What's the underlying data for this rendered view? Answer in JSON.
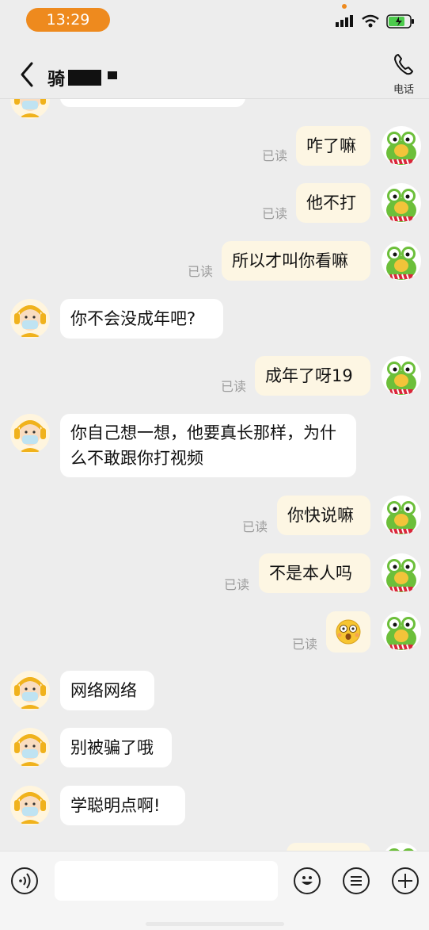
{
  "status_bar": {
    "time": "13:29"
  },
  "header": {
    "title": "骑",
    "phone_label": "电话"
  },
  "read_label": "已读",
  "messages": [
    {
      "from": "other",
      "text": ""
    },
    {
      "from": "me",
      "text": "咋了嘛"
    },
    {
      "from": "me",
      "text": "他不打"
    },
    {
      "from": "me",
      "text": "所以才叫你看嘛"
    },
    {
      "from": "other",
      "text": "你不会没成年吧?"
    },
    {
      "from": "me",
      "text": "成年了呀19"
    },
    {
      "from": "other",
      "text": "你自己想一想，他要真长那样，为什么不敢跟你打视频"
    },
    {
      "from": "me",
      "text": "你快说嘛"
    },
    {
      "from": "me",
      "text": "不是本人吗"
    },
    {
      "from": "me",
      "text": "",
      "emoji": "shocked-face-emoji"
    },
    {
      "from": "other",
      "text": "网络网络"
    },
    {
      "from": "other",
      "text": "别被骗了哦"
    },
    {
      "from": "other",
      "text": "学聪明点啊!"
    },
    {
      "from": "me",
      "text": ""
    }
  ],
  "input": {
    "value": "",
    "placeholder": ""
  },
  "colors": {
    "accent": "#ee8a1e",
    "my_bubble": "#fdf6e3",
    "other_bubble": "#ffffff",
    "background": "#ededed"
  }
}
